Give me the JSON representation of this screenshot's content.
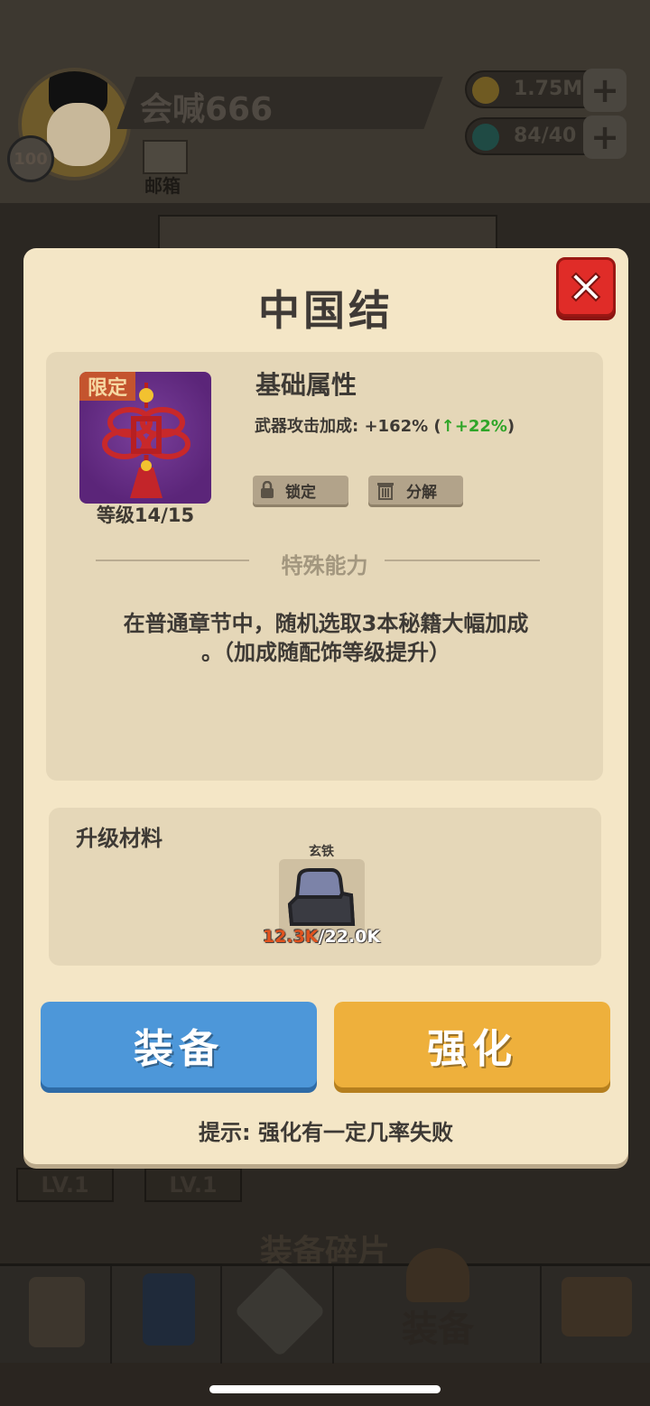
{
  "header": {
    "username": "会喊666",
    "player_level": "100",
    "mail_label": "邮箱",
    "coins": "1.75M",
    "energy": "84/40",
    "plus_symbol": "+"
  },
  "background": {
    "slot_level_1": "LV.1",
    "slot_level_2": "LV.1",
    "fragments_title": "装备碎片",
    "nav_active_label": "装备"
  },
  "dialog": {
    "title": "中国结",
    "item": {
      "limited_tag": "限定",
      "level_text": "等级14/15"
    },
    "attributes": {
      "title": "基础属性",
      "stat_label": "武器攻击加成: +162% (",
      "stat_bonus": "↑+22%",
      "stat_suffix": ")",
      "lock_label": "锁定",
      "decompose_label": "分解"
    },
    "special": {
      "title": "特殊能力",
      "description_line1": "在普通章节中，随机选取3本秘籍大幅加成",
      "description_line2": "。（加成随配饰等级提升）"
    },
    "materials": {
      "title": "升级材料",
      "item_name": "玄铁",
      "current": "12.3K",
      "required": "/22.0K"
    },
    "buttons": {
      "equip": "装备",
      "enhance": "强化"
    },
    "hint": "提示: 强化有一定几率失败"
  },
  "colors": {
    "dialog_bg": "#f4e6c6",
    "panel_bg": "#e5d7b8",
    "equip_blue": "#4d97d9",
    "enhance_orange": "#eeb03c",
    "close_red": "#e02c28",
    "bonus_green": "#2fa528",
    "material_current_red": "#e0531e"
  }
}
